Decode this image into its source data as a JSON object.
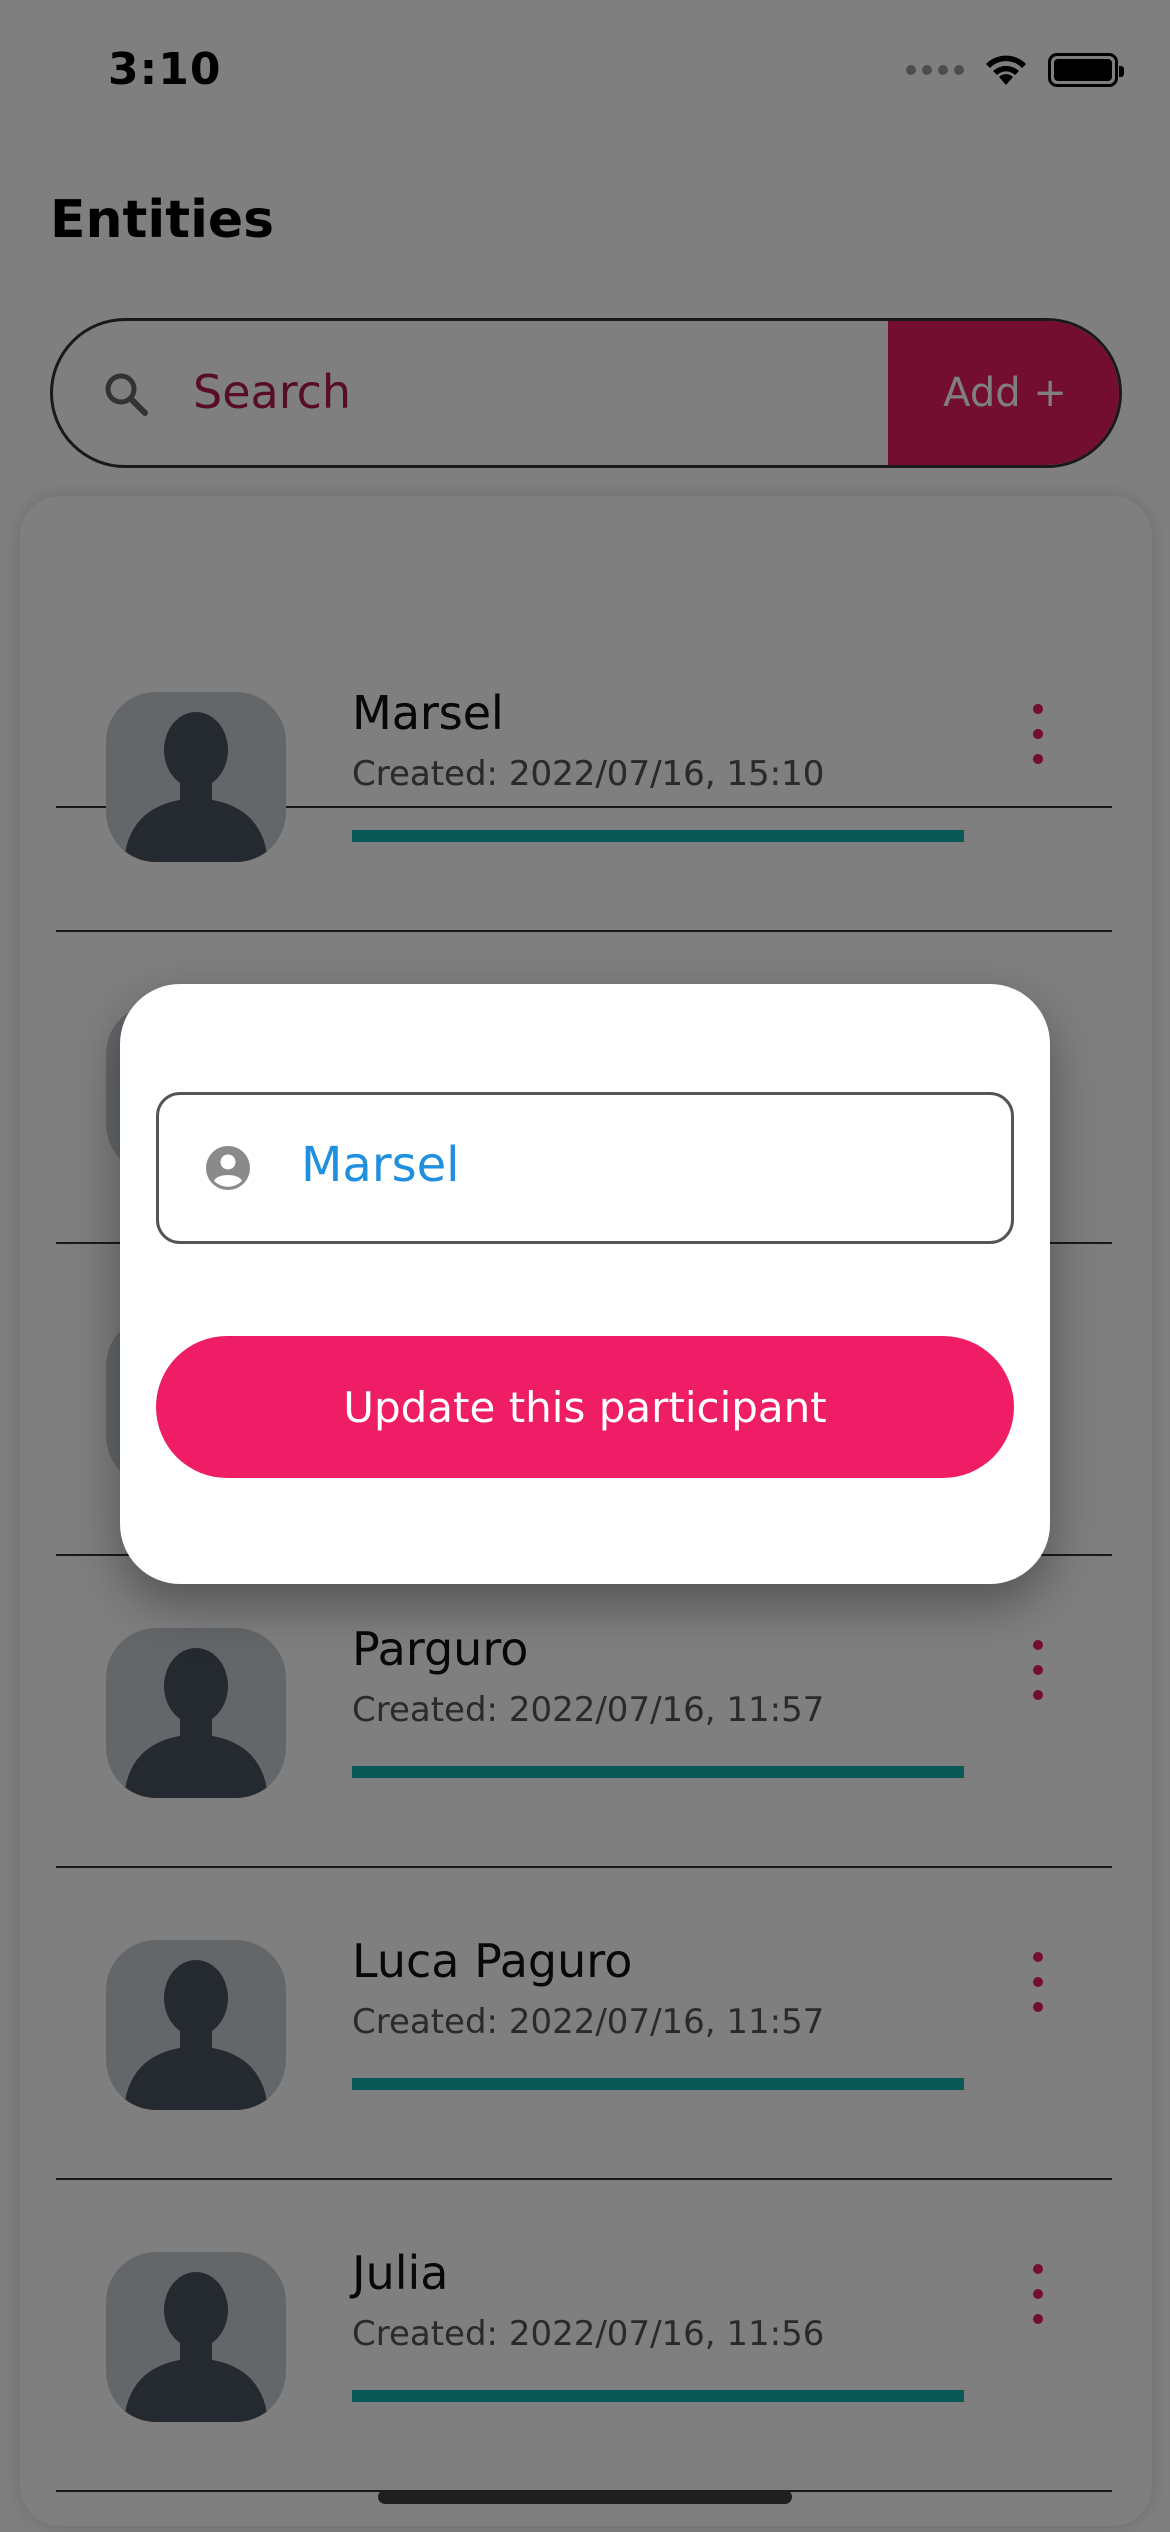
{
  "status_bar": {
    "time": "3:10"
  },
  "header": {
    "title": "Entities"
  },
  "search": {
    "placeholder": "Search",
    "add_label": "Add +"
  },
  "entities": [
    {
      "name": "Marsel",
      "created_label": "Created:",
      "created": "2022/07/16, 15:10"
    },
    {
      "name": "",
      "created_label": "",
      "created": ""
    },
    {
      "name": "",
      "created_label": "",
      "created": ""
    },
    {
      "name": "Parguro",
      "created_label": "Created:",
      "created": "2022/07/16, 11:57"
    },
    {
      "name": "Luca Paguro",
      "created_label": "Created:",
      "created": "2022/07/16, 11:57"
    },
    {
      "name": "Julia",
      "created_label": "Created:",
      "created": "2022/07/16, 11:56"
    }
  ],
  "modal": {
    "input_value": "Marsel",
    "button_label": "Update this participant"
  },
  "colors": {
    "accent": "#e61c63",
    "progress": "#17b2ac",
    "input_text": "#1f8fe0"
  },
  "icons": [
    "search-icon",
    "avatar-icon",
    "more-vertical-icon",
    "user-circle-icon",
    "wifi-icon",
    "battery-icon"
  ]
}
